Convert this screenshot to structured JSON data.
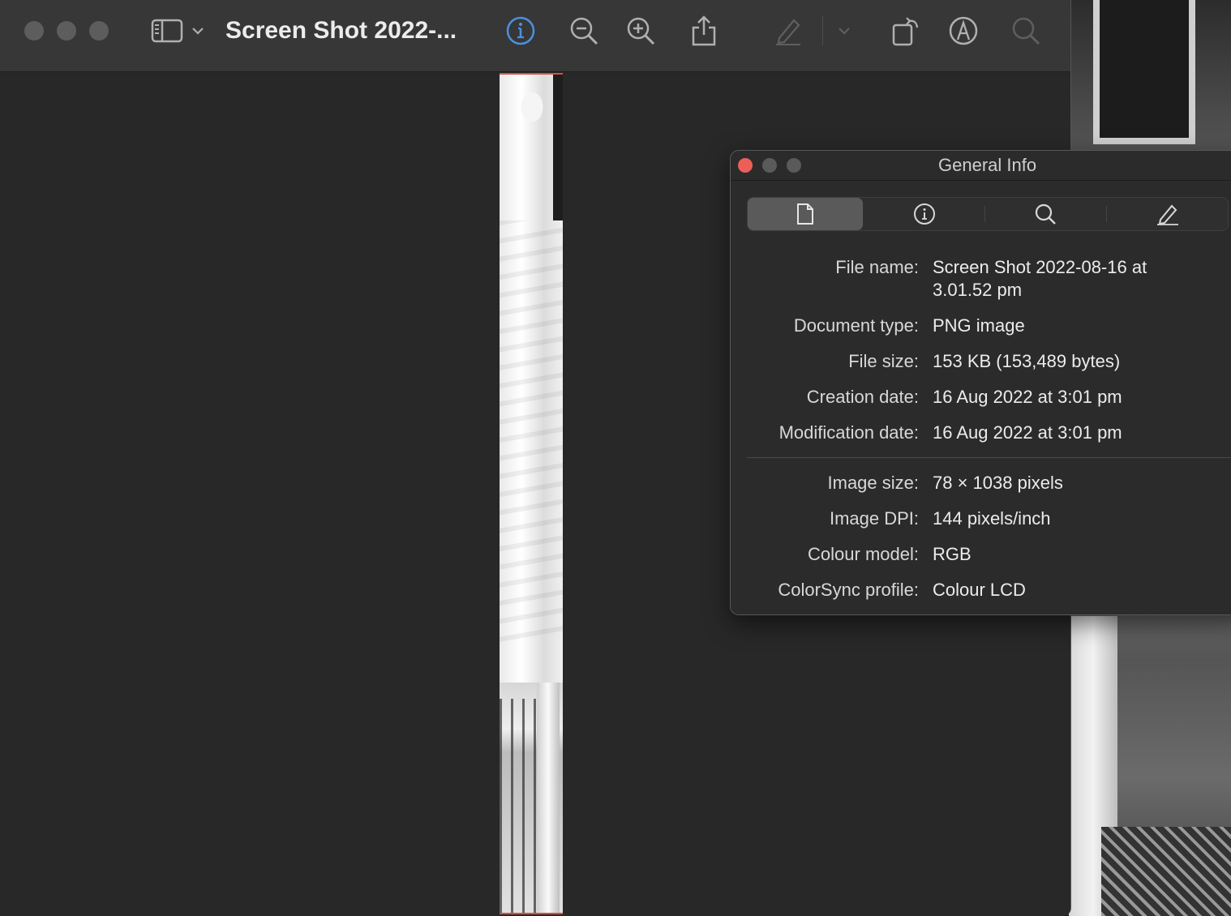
{
  "window": {
    "title": "Screen Shot 2022-..."
  },
  "toolbar": {
    "icons": [
      "sidebar-icon",
      "chevron-down-icon",
      "info-icon",
      "zoom-out-icon",
      "zoom-in-icon",
      "share-icon",
      "highlight-pen-icon",
      "chevron-down-icon",
      "rotate-icon",
      "markup-icon",
      "search-icon"
    ],
    "active_accent": "#4a90e2"
  },
  "inspector": {
    "title": "General Info",
    "tabs": [
      "document-icon",
      "info-icon",
      "search-icon",
      "pen-icon"
    ],
    "active_tab": 0,
    "close_color": "#ec5f57",
    "general": [
      {
        "label": "File name:",
        "value": "Screen Shot 2022-08-16 at 3.01.52 pm"
      },
      {
        "label": "Document type:",
        "value": "PNG image"
      },
      {
        "label": "File size:",
        "value": "153 KB (153,489 bytes)"
      },
      {
        "label": "Creation date:",
        "value": "16 Aug 2022 at 3:01 pm"
      },
      {
        "label": "Modification date:",
        "value": "16 Aug 2022 at 3:01 pm"
      }
    ],
    "image": [
      {
        "label": "Image size:",
        "value": "78 × 1038 pixels"
      },
      {
        "label": "Image DPI:",
        "value": "144 pixels/inch"
      },
      {
        "label": "Colour model:",
        "value": "RGB"
      },
      {
        "label": "ColorSync profile:",
        "value": "Colour LCD"
      }
    ]
  }
}
